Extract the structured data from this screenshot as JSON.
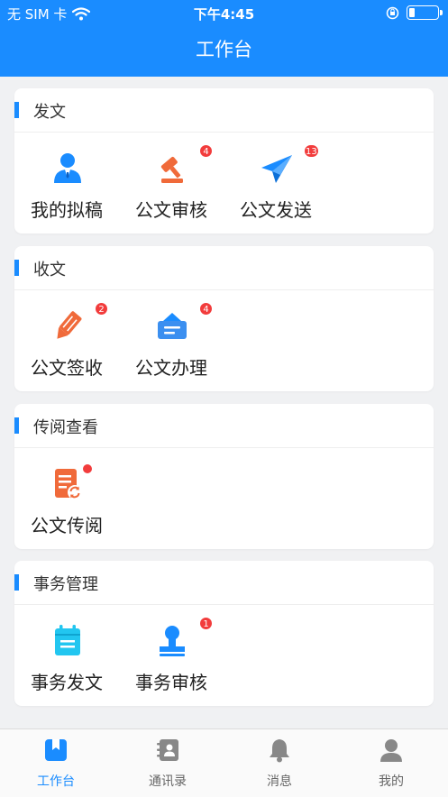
{
  "status_bar": {
    "carrier": "无 SIM 卡",
    "time": "下午4:45"
  },
  "header": {
    "title": "工作台"
  },
  "sections": [
    {
      "title": "发文",
      "items": [
        {
          "label": "我的拟稿",
          "icon": "user-suit-icon",
          "badge": ""
        },
        {
          "label": "公文审核",
          "icon": "gavel-icon",
          "badge": "4"
        },
        {
          "label": "公文发送",
          "icon": "paper-plane-icon",
          "badge": "13"
        }
      ]
    },
    {
      "title": "收文",
      "items": [
        {
          "label": "公文签收",
          "icon": "pencil-icon",
          "badge": "2"
        },
        {
          "label": "公文办理",
          "icon": "inbox-tray-icon",
          "badge": "4"
        }
      ]
    },
    {
      "title": "传阅查看",
      "items": [
        {
          "label": "公文传阅",
          "icon": "document-refresh-icon",
          "badge_dot": true
        }
      ]
    },
    {
      "title": "事务管理",
      "items": [
        {
          "label": "事务发文",
          "icon": "calendar-doc-icon",
          "badge": ""
        },
        {
          "label": "事务审核",
          "icon": "stamp-icon",
          "badge": "1"
        }
      ]
    }
  ],
  "tabbar": [
    {
      "label": "工作台",
      "icon": "workbench-icon",
      "active": true
    },
    {
      "label": "通讯录",
      "icon": "contacts-book-icon",
      "active": false
    },
    {
      "label": "消息",
      "icon": "bell-icon",
      "active": false
    },
    {
      "label": "我的",
      "icon": "person-icon",
      "active": false
    }
  ],
  "colors": {
    "primary": "#1a8cff",
    "badge": "#f23c3c",
    "background": "#f0f1f3"
  }
}
